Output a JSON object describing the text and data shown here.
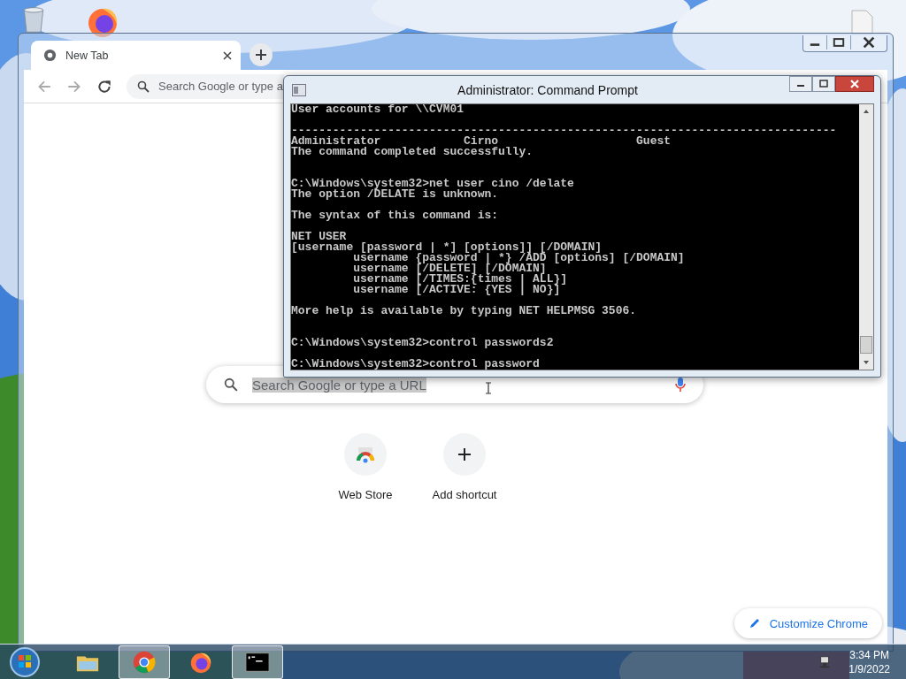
{
  "browser": {
    "tabs": [
      {
        "title": "New Tab",
        "selected": true
      }
    ],
    "omnibox": {
      "placeholder": "Search Google or type a"
    },
    "search": {
      "placeholder": "Search Google or type a URL",
      "highlighted": true
    },
    "shortcuts": [
      {
        "label": "Web Store",
        "kind": "webstore"
      },
      {
        "label": "Add shortcut",
        "kind": "add"
      }
    ],
    "customize_button": "Customize Chrome"
  },
  "console": {
    "title": "Administrator: Command Prompt",
    "text": "User accounts for \\\\CVM01\n\n-------------------------------------------------------------------------------\nAdministrator            Cirno                    Guest\nThe command completed successfully.\n\n\nC:\\Windows\\system32>net user cino /delate\nThe option /DELATE is unknown.\n\nThe syntax of this command is:\n\nNET USER\n[username [password | *] [options]] [/DOMAIN]\n         username {password | *} /ADD [options] [/DOMAIN]\n         username [/DELETE] [/DOMAIN]\n         username [/TIMES:{times | ALL}]\n         username [/ACTIVE: {YES | NO}]\n\nMore help is available by typing NET HELPMSG 3506.\n\n\nC:\\Windows\\system32>control passwords2\n\nC:\\Windows\\system32>control password"
  },
  "taskbar": {
    "apps": [
      {
        "kind": "explorer",
        "active": false
      },
      {
        "kind": "chrome",
        "active": true
      },
      {
        "kind": "firefox",
        "active": false
      },
      {
        "kind": "console",
        "active": true
      }
    ],
    "time": "3:34 PM",
    "date": "1/9/2022"
  }
}
